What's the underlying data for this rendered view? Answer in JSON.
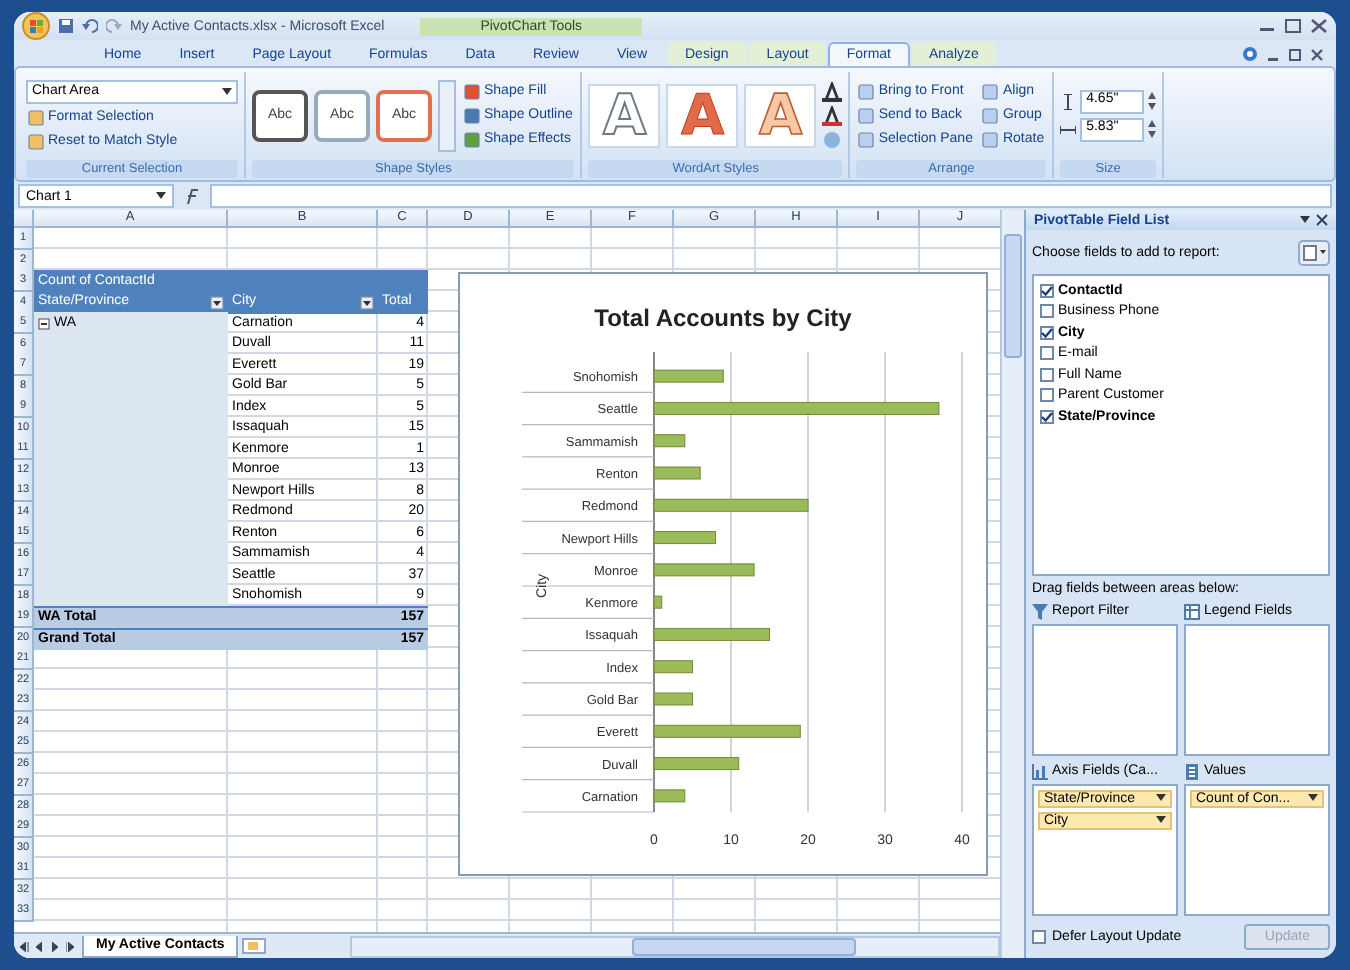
{
  "window": {
    "title": "My Active Contacts.xlsx - Microsoft Excel",
    "context_label": "PivotChart Tools"
  },
  "ribbon": {
    "tabs": [
      {
        "label": "Home",
        "selected": false,
        "contextual": false
      },
      {
        "label": "Insert",
        "selected": false,
        "contextual": false
      },
      {
        "label": "Page Layout",
        "selected": false,
        "contextual": false
      },
      {
        "label": "Formulas",
        "selected": false,
        "contextual": false
      },
      {
        "label": "Data",
        "selected": false,
        "contextual": false
      },
      {
        "label": "Review",
        "selected": false,
        "contextual": false
      },
      {
        "label": "View",
        "selected": false,
        "contextual": false
      },
      {
        "label": "Design",
        "selected": false,
        "contextual": true
      },
      {
        "label": "Layout",
        "selected": false,
        "contextual": true
      },
      {
        "label": "Format",
        "selected": true,
        "contextual": true
      },
      {
        "label": "Analyze",
        "selected": false,
        "contextual": true
      }
    ],
    "groups": [
      {
        "kind": "selection",
        "title": "Current Selection",
        "dropdown": "Chart Area",
        "items": [
          "Format Selection",
          "Reset to Match Style"
        ]
      },
      {
        "kind": "shape_styles",
        "title": "Shape Styles",
        "swatches": [
          "Abc",
          "Abc",
          "Abc"
        ],
        "items": [
          "Shape Fill",
          "Shape Outline",
          "Shape Effects"
        ]
      },
      {
        "kind": "wordart",
        "title": "WordArt Styles",
        "samples": [
          "A",
          "A",
          "A"
        ]
      },
      {
        "kind": "arrange",
        "title": "Arrange",
        "items": [
          "Bring to Front",
          "Send to Back",
          "Selection Pane",
          "Align",
          "Group",
          "Rotate"
        ]
      },
      {
        "kind": "size",
        "title": "Size",
        "items": [
          "4.65\"",
          "5.83\""
        ]
      }
    ]
  },
  "name_box": "Chart 1",
  "sheet": {
    "columns": [
      "A",
      "B",
      "C",
      "D",
      "E",
      "F",
      "G",
      "H",
      "I",
      "J"
    ],
    "row_numbers": [
      "1",
      "2",
      "3",
      "4",
      "5",
      "6",
      "7",
      "8",
      "9",
      "10",
      "11",
      "12",
      "13",
      "14",
      "15",
      "16",
      "17",
      "18",
      "19",
      "20",
      "21",
      "22",
      "23",
      "24",
      "25",
      "26",
      "27",
      "28",
      "29",
      "30",
      "31",
      "32",
      "33"
    ],
    "pivot": {
      "title": "Count of ContactId",
      "row_header": "State/Province",
      "column_header": "City",
      "value_header": "Total",
      "group": "WA",
      "rows": [
        {
          "city": "Carnation",
          "count": "4"
        },
        {
          "city": "Duvall",
          "count": "11"
        },
        {
          "city": "Everett",
          "count": "19"
        },
        {
          "city": "Gold Bar",
          "count": "5"
        },
        {
          "city": "Index",
          "count": "5"
        },
        {
          "city": "Issaquah",
          "count": "15"
        },
        {
          "city": "Kenmore",
          "count": "1"
        },
        {
          "city": "Monroe",
          "count": "13"
        },
        {
          "city": "Newport Hills",
          "count": "8"
        },
        {
          "city": "Redmond",
          "count": "20"
        },
        {
          "city": "Renton",
          "count": "6"
        },
        {
          "city": "Sammamish",
          "count": "4"
        },
        {
          "city": "Seattle",
          "count": "37"
        },
        {
          "city": "Snohomish",
          "count": "9"
        }
      ],
      "subtotal": {
        "label": "WA Total",
        "value": "157"
      },
      "grand_total": {
        "label": "Grand Total",
        "value": "157"
      }
    },
    "chart": {
      "chart_data": {
        "type": "bar",
        "orientation": "horizontal",
        "title": "Total Accounts by City",
        "ylabel": "City",
        "categories": [
          "Snohomish",
          "Seattle",
          "Sammamish",
          "Renton",
          "Redmond",
          "Newport Hills",
          "Monroe",
          "Kenmore",
          "Issaquah",
          "Index",
          "Gold Bar",
          "Everett",
          "Duvall",
          "Carnation"
        ],
        "series": [
          {
            "color": "#9bbb59",
            "values": [
              9,
              37,
              4,
              6,
              20,
              8,
              13,
              1,
              15,
              5,
              5,
              19,
              11,
              4
            ]
          }
        ],
        "xlim": [
          0,
          40
        ],
        "xticks": [
          0,
          10,
          20,
          30,
          40
        ],
        "grid": true
      }
    },
    "sheet_tabs": [
      {
        "label": "My Active Contacts",
        "selected": true
      }
    ]
  },
  "field_list": {
    "title": "PivotTable Field List",
    "prompt": "Choose fields to add to report:",
    "fields": [
      {
        "label": "ContactId",
        "checked": true
      },
      {
        "label": "Business Phone",
        "checked": false
      },
      {
        "label": "City",
        "checked": true
      },
      {
        "label": "E-mail",
        "checked": false
      },
      {
        "label": "Full Name",
        "checked": false
      },
      {
        "label": "Parent Customer",
        "checked": false
      },
      {
        "label": "State/Province",
        "checked": true
      }
    ],
    "areas_prompt": "Drag fields between areas below:",
    "areas": [
      {
        "kind": "filter",
        "label": "Report Filter"
      },
      {
        "kind": "legend",
        "label": "Legend Fields"
      },
      {
        "kind": "axis",
        "label": "Axis Fields (Ca...",
        "items": [
          "State/Province",
          "City"
        ]
      },
      {
        "kind": "values",
        "label": "Values",
        "items": [
          "Count of Con..."
        ]
      }
    ],
    "defer": {
      "label": "Defer Layout Update",
      "checked": false
    },
    "update": {
      "label": "Update",
      "disabled": true
    }
  }
}
